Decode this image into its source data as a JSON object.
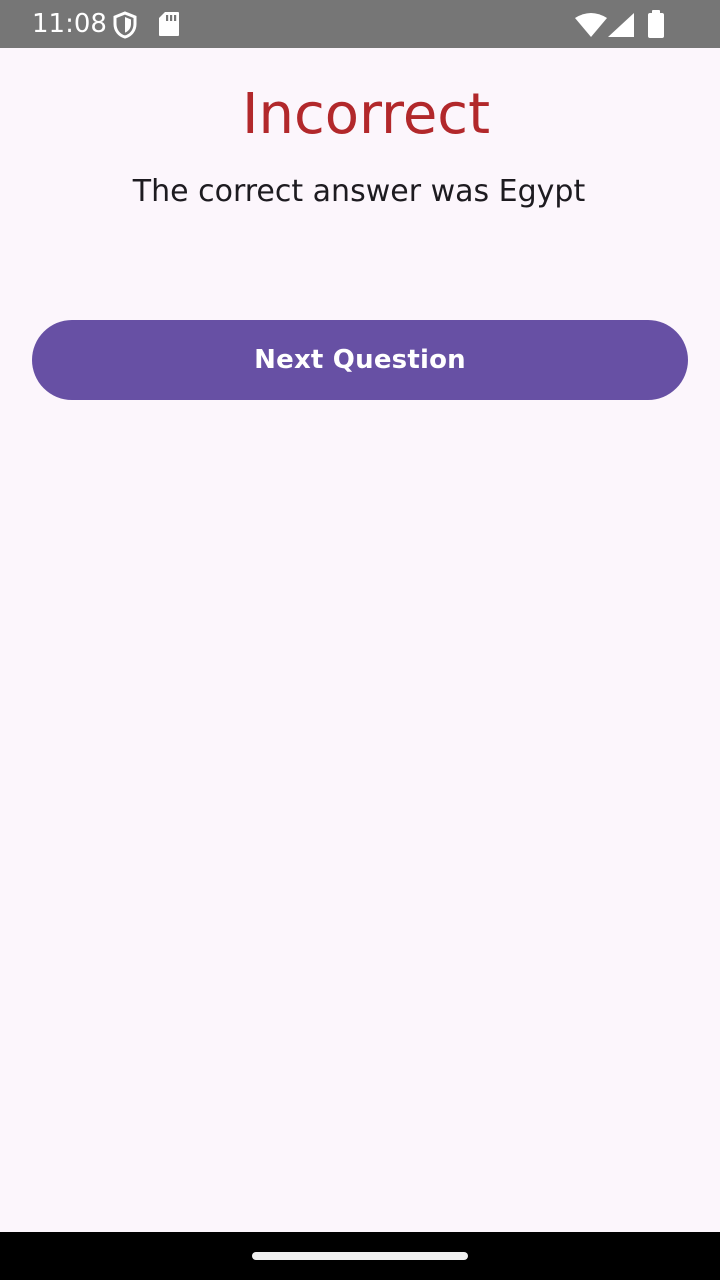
{
  "status_bar": {
    "time": "11:08",
    "icons": [
      "shield-icon",
      "sd-card-icon",
      "wifi-icon",
      "cell-signal-icon",
      "battery-icon"
    ]
  },
  "result": {
    "title": "Incorrect",
    "message": "The correct answer was Egypt"
  },
  "actions": {
    "next_label": "Next Question"
  },
  "colors": {
    "incorrect": "#b2282b",
    "primary": "#6750a4",
    "background": "#fcf6fc",
    "status_bar": "#767676",
    "nav_bar": "#000000"
  }
}
